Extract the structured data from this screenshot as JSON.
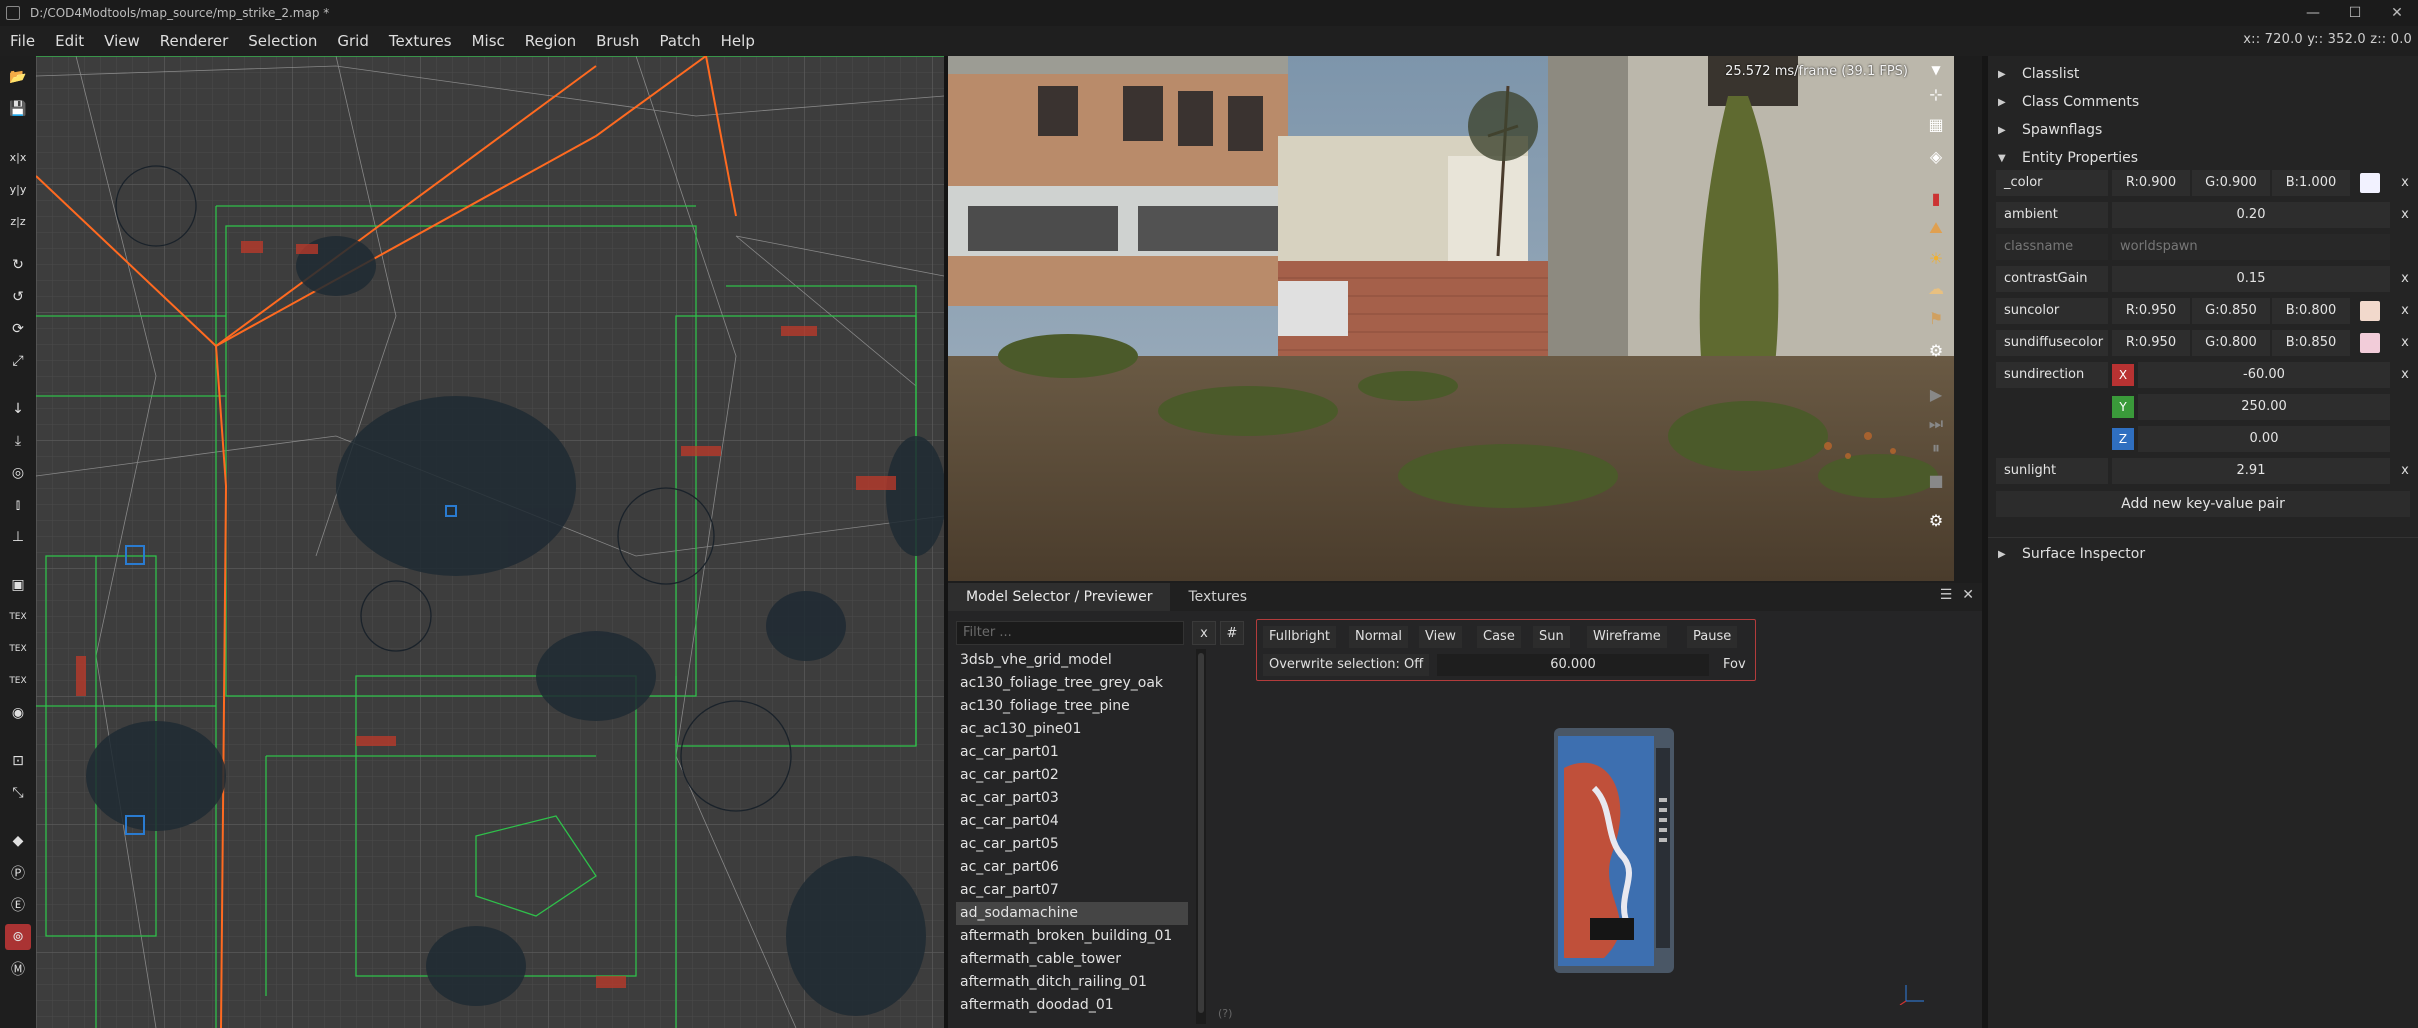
{
  "window": {
    "title": "D:/COD4Modtools/map_source/mp_strike_2.map *",
    "controls": [
      "—",
      "☐",
      "✕"
    ]
  },
  "menu": {
    "items": [
      "File",
      "Edit",
      "View",
      "Renderer",
      "Selection",
      "Grid",
      "Textures",
      "Misc",
      "Region",
      "Brush",
      "Patch",
      "Help"
    ],
    "coords": "x:: 720.0  y:: 352.0  z:: 0.0"
  },
  "left_toolbar": {
    "tools": [
      "x|x",
      "y|y",
      "z|z",
      "rotate-x-icon",
      "rotate-y-icon",
      "rotate-z-icon",
      "scale-icon",
      "arrow-down-icon",
      "drop-icon",
      "ring-icon",
      "pillar-icon",
      "stairs-icon",
      "tex-x-icon",
      "tex-y-icon",
      "tex-50-icon",
      "lod-icon",
      "scale-box-icon",
      "resize-icon",
      "cube-icon",
      "p-icon",
      "e-icon",
      "record-icon",
      "m-icon"
    ]
  },
  "camera": {
    "fps": "25.572 ms/frame (39.1 FPS)"
  },
  "model_selector": {
    "tabs": [
      "Model Selector / Previewer",
      "Textures"
    ],
    "filter_placeholder": "Filter ...",
    "clear_label": "x",
    "hash_label": "#",
    "models": [
      "3dsb_vhe_grid_model",
      "ac130_foliage_tree_grey_oak",
      "ac130_foliage_tree_pine",
      "ac_ac130_pine01",
      "ac_car_part01",
      "ac_car_part02",
      "ac_car_part03",
      "ac_car_part04",
      "ac_car_part05",
      "ac_car_part06",
      "ac_car_part07",
      "ad_sodamachine",
      "aftermath_broken_building_01",
      "aftermath_cable_tower",
      "aftermath_ditch_railing_01",
      "aftermath_doodad_01"
    ],
    "selected_model": "ad_sodamachine",
    "preview_buttons": [
      "Fullbright",
      "Normal",
      "View",
      "Case",
      "Sun",
      "Wireframe",
      "Pause"
    ],
    "overwrite_label": "Overwrite selection: Off",
    "fov_value": "60.000",
    "fov_label": "Fov",
    "help_marker": "(?)"
  },
  "entity_panel": {
    "sections": {
      "classlist": "Classlist",
      "class_comments": "Class Comments",
      "spawnflags": "Spawnflags",
      "entity_properties": "Entity Properties",
      "surface_inspector": "Surface Inspector"
    },
    "properties": {
      "color": {
        "key": "_color",
        "r": "R:0.900",
        "g": "G:0.900",
        "b": "B:1.000",
        "swatch": "#f2f2ff"
      },
      "ambient": {
        "key": "ambient",
        "value": "0.20"
      },
      "classname": {
        "key": "classname",
        "value": "worldspawn"
      },
      "contrastgain": {
        "key": "contrastGain",
        "value": "0.15"
      },
      "suncolor": {
        "key": "suncolor",
        "r": "R:0.950",
        "g": "G:0.850",
        "b": "B:0.800",
        "swatch": "#f2d9cc"
      },
      "sundiffusecolor": {
        "key": "sundiffusecolor",
        "r": "R:0.950",
        "g": "G:0.800",
        "b": "B:0.850",
        "swatch": "#f2ccd9"
      },
      "sundirection": {
        "key": "sundirection",
        "x_tag": "X",
        "x": "-60.00",
        "y_tag": "Y",
        "y": "250.00",
        "z_tag": "Z",
        "z": "0.00"
      },
      "sunlight": {
        "key": "sunlight",
        "value": "2.91"
      }
    },
    "delete_label": "x",
    "add_pair_label": "Add new key-value pair"
  },
  "colors": {
    "axis_x": "#b83232",
    "axis_y": "#3a9a3a",
    "axis_z": "#2f6fc0",
    "accent_red": "#b33c3c"
  }
}
